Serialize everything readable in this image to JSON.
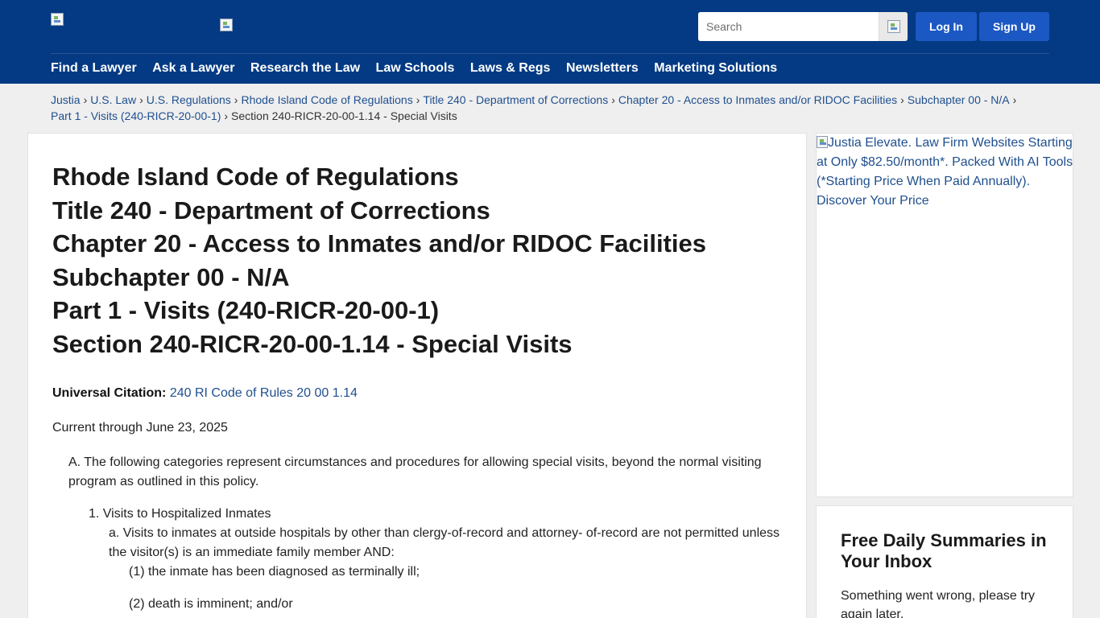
{
  "header": {
    "search_placeholder": "Search",
    "login_label": "Log In",
    "signup_label": "Sign Up"
  },
  "nav": [
    "Find a Lawyer",
    "Ask a Lawyer",
    "Research the Law",
    "Law Schools",
    "Laws & Regs",
    "Newsletters",
    "Marketing Solutions"
  ],
  "breadcrumb": {
    "links": [
      "Justia",
      "U.S. Law",
      "U.S. Regulations",
      "Rhode Island Code of Regulations",
      "Title 240 - Department of Corrections",
      "Chapter 20 - Access to Inmates and/or RIDOC Facilities",
      "Subchapter 00 - N/A",
      "Part 1 - Visits (240-RICR-20-00-1)"
    ],
    "separator": "›",
    "current": "Section 240-RICR-20-00-1.14 - Special Visits"
  },
  "main": {
    "title_lines": [
      "Rhode Island Code of Regulations",
      "Title 240 - Department of Corrections",
      "Chapter 20 - Access to Inmates and/or RIDOC Facilities",
      "Subchapter 00 - N/A",
      "Part 1 - Visits (240-RICR-20-00-1)",
      "Section 240-RICR-20-00-1.14 - Special Visits"
    ],
    "citation_label": "Universal Citation:",
    "citation_value": "240 RI Code of Rules 20 00 1.14",
    "current_through": "Current through June 23, 2025",
    "para_a": "A. The following categories represent circumstances and procedures for allowing special visits, beyond the normal visiting program as outlined in this policy.",
    "item_1": "1. Visits to Hospitalized Inmates",
    "item_1a": "a. Visits to inmates at outside hospitals by other than clergy-of-record and attorney- of-record are not permitted unless the visitor(s) is an immediate family member AND:",
    "item_sub1": "(1) the inmate has been diagnosed as terminally ill;",
    "item_sub2": "(2) death is imminent; and/or"
  },
  "ad": {
    "alt_text": "Justia Elevate. Law Firm Websites Starting at Only $82.50/month*. Packed With AI Tools (*Starting Price When Paid Annually). Discover Your Price"
  },
  "newsletter": {
    "title": "Free Daily Summaries in Your Inbox",
    "error": "Something went wrong, please try again later."
  }
}
